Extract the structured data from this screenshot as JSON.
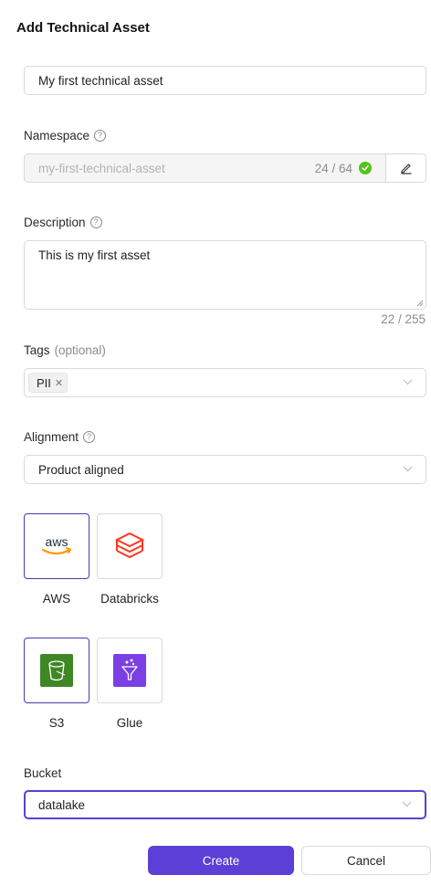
{
  "dialog": {
    "title": "Add Technical Asset"
  },
  "name_field": {
    "value": "My first technical asset"
  },
  "namespace": {
    "label": "Namespace",
    "value": "my-first-technical-asset",
    "count": "24 / 64",
    "help_icon": "question-circle-icon",
    "edit_icon": "pencil-icon",
    "valid_icon": "check-circle-icon"
  },
  "description": {
    "label": "Description",
    "value": "This is my first asset",
    "count": "22 / 255",
    "help_icon": "question-circle-icon"
  },
  "tags": {
    "label": "Tags",
    "optional_text": "(optional)",
    "items": [
      {
        "label": "PII"
      }
    ]
  },
  "alignment": {
    "label": "Alignment",
    "value": "Product aligned",
    "help_icon": "question-circle-icon"
  },
  "platforms": [
    {
      "label": "AWS",
      "icon": "aws-logo-icon",
      "selected": true
    },
    {
      "label": "Databricks",
      "icon": "databricks-logo-icon",
      "selected": false
    }
  ],
  "services": [
    {
      "label": "S3",
      "icon": "s3-bucket-icon",
      "selected": true
    },
    {
      "label": "Glue",
      "icon": "glue-icon",
      "selected": false
    }
  ],
  "bucket": {
    "label": "Bucket",
    "value": "datalake"
  },
  "actions": {
    "create_label": "Create",
    "cancel_label": "Cancel"
  },
  "colors": {
    "primary": "#5b3fd6",
    "success": "#52c41a",
    "aws_orange": "#ff9900",
    "databricks": "#ff3621",
    "s3_green": "#3f8624",
    "glue_purple": "#7b3fe4"
  }
}
